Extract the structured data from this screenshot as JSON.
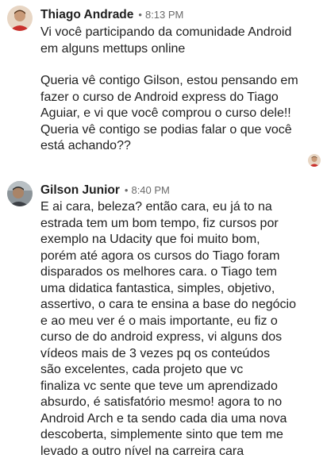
{
  "messages": [
    {
      "author": "Thiago Andrade",
      "separator": "•",
      "time": "8:13 PM",
      "paragraphs": [
        [
          "Vi você participando da comunidade Android",
          "em alguns mettups online"
        ],
        [
          "Queria vê contigo Gilson, estou pensando em",
          "fazer o curso de Android express do Tiago",
          "Aguiar, e vi que você comprou o curso dele!!",
          "Queria vê contigo se podias falar o que você",
          "está achando??"
        ]
      ]
    },
    {
      "author": "Gilson Junior",
      "separator": "•",
      "time": "8:40 PM",
      "paragraphs": [
        [
          "E ai cara, beleza? então cara, eu já to na",
          "estrada tem um bom tempo, fiz cursos por",
          "exemplo na Udacity que foi muito bom,",
          "porém até agora os cursos do Tiago foram",
          "disparados os melhores cara. o Tiago tem",
          "uma didatica fantastica, simples, objetivo,",
          "assertivo, o cara te ensina a base do negócio",
          "e ao meu ver é o mais importante, eu fiz o",
          "curso de do android express, vi alguns dos",
          "vídeos mais de 3 vezes pq os conteúdos",
          "são excelentes, cada projeto que vc",
          "finaliza vc sente que teve um aprendizado",
          "absurdo, é satisfatório mesmo! agora to no",
          "Android Arch e ta sendo cada dia uma nova",
          "descoberta, simplemente sinto que tem me",
          "levado a outro nível na carreira cara"
        ]
      ]
    }
  ]
}
